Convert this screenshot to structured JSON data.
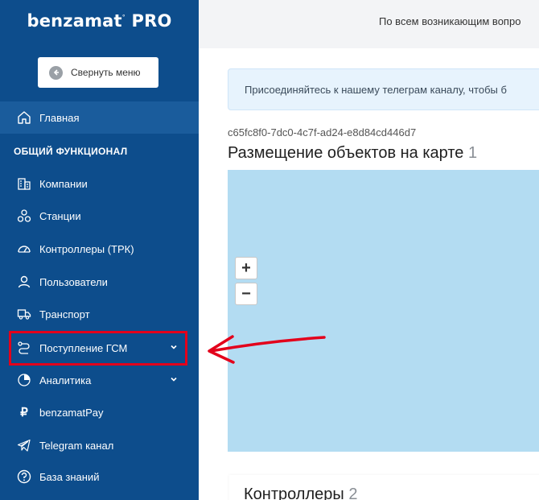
{
  "brand": {
    "name": "benzamat",
    "mark": "°",
    "suffix": "PRO"
  },
  "sidebar": {
    "collapse_label": "Свернуть меню",
    "home_label": "Главная",
    "section_title": "ОБЩИЙ ФУНКЦИОНАЛ",
    "items": [
      {
        "label": "Компании",
        "icon": "buildings-icon"
      },
      {
        "label": "Станции",
        "icon": "nodes-icon"
      },
      {
        "label": "Контроллеры (ТРК)",
        "icon": "gauge-icon"
      },
      {
        "label": "Пользователи",
        "icon": "user-icon"
      },
      {
        "label": "Транспорт",
        "icon": "truck-icon"
      },
      {
        "label": "Поступление ГСМ",
        "icon": "route-icon",
        "expandable": true,
        "highlighted": true
      },
      {
        "label": "Аналитика",
        "icon": "pie-chart-icon",
        "expandable": true
      },
      {
        "label": "benzamatPay",
        "icon": "ruble-icon"
      },
      {
        "label": "Telegram канал",
        "icon": "telegram-icon"
      },
      {
        "label": "База знаний",
        "icon": "question-icon"
      }
    ]
  },
  "topbar": {
    "text": "По всем возникающим вопро"
  },
  "main": {
    "banner": "Присоединяйтесь к нашему телеграм каналу, чтобы б",
    "uuid": "c65fc8f0-7dc0-4c7f-ad24-e8d84cd446d7",
    "map_title": "Размещение объектов на карте",
    "map_count": "1",
    "zoom_in": "+",
    "zoom_out": "−",
    "controllers_title": "Контроллеры",
    "controllers_count": "2"
  },
  "colors": {
    "sidebar": "#0d4d8c",
    "highlight": "#e3001b",
    "map": "#b3dcf2"
  }
}
